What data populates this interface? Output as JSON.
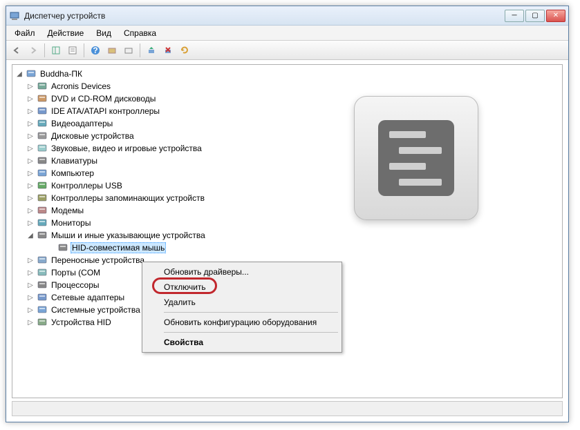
{
  "title": "Диспетчер устройств",
  "menu": {
    "file": "Файл",
    "action": "Действие",
    "view": "Вид",
    "help": "Справка"
  },
  "root": "Buddha-ПК",
  "categories": [
    {
      "label": "Acronis Devices",
      "icon": "device"
    },
    {
      "label": "DVD и CD-ROM дисководы",
      "icon": "disc"
    },
    {
      "label": "IDE ATA/ATAPI контроллеры",
      "icon": "controller"
    },
    {
      "label": "Видеоадаптеры",
      "icon": "display"
    },
    {
      "label": "Дисковые устройства",
      "icon": "disk"
    },
    {
      "label": "Звуковые, видео и игровые устройства",
      "icon": "sound"
    },
    {
      "label": "Клавиатуры",
      "icon": "keyboard"
    },
    {
      "label": "Компьютер",
      "icon": "computer"
    },
    {
      "label": "Контроллеры USB",
      "icon": "usb"
    },
    {
      "label": "Контроллеры запоминающих устройств",
      "icon": "storage"
    },
    {
      "label": "Модемы",
      "icon": "modem"
    },
    {
      "label": "Мониторы",
      "icon": "monitor"
    },
    {
      "label": "Мыши и иные указывающие устройства",
      "icon": "mouse",
      "expanded": true,
      "children": [
        {
          "label": "HID-совместимая мышь",
          "icon": "mouse",
          "selected": true
        }
      ]
    },
    {
      "label": "Переносные устройства",
      "icon": "portable",
      "truncated": true
    },
    {
      "label": "Порты (COM и LPT)",
      "icon": "port",
      "truncated": true
    },
    {
      "label": "Процессоры",
      "icon": "cpu"
    },
    {
      "label": "Сетевые адаптеры",
      "icon": "network",
      "truncated": true
    },
    {
      "label": "Системные устройства",
      "icon": "system",
      "truncated": true
    },
    {
      "label": "Устройства HID",
      "icon": "hid",
      "truncated": true
    }
  ],
  "contextMenu": {
    "items": [
      {
        "label": "Обновить драйверы...",
        "type": "item"
      },
      {
        "label": "Отключить",
        "type": "item",
        "highlighted": true
      },
      {
        "label": "Удалить",
        "type": "item"
      },
      {
        "type": "sep"
      },
      {
        "label": "Обновить конфигурацию оборудования",
        "type": "item"
      },
      {
        "type": "sep"
      },
      {
        "label": "Свойства",
        "type": "item",
        "bold": true
      }
    ]
  }
}
